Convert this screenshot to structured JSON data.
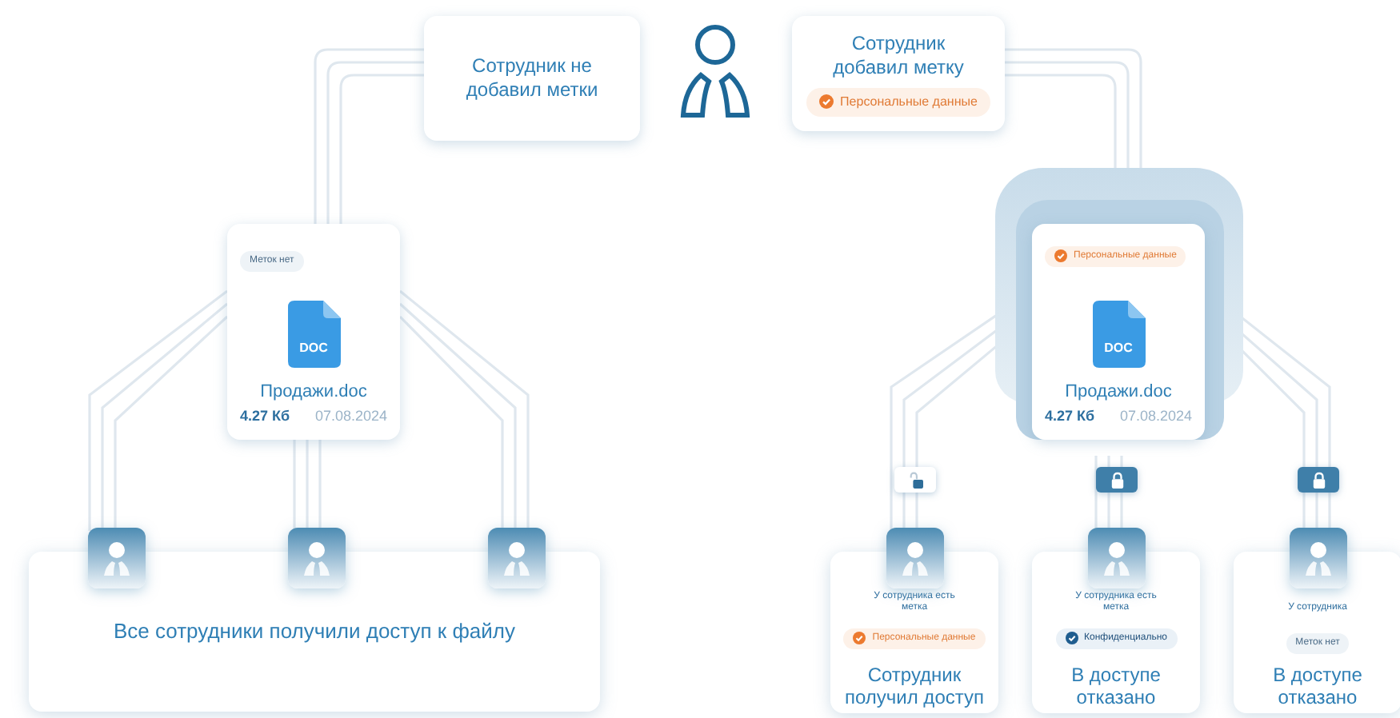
{
  "left_prompt": {
    "text": "Сотрудник не добавил метки"
  },
  "right_prompt": {
    "text": "Сотрудник добавил метку",
    "tag": {
      "kind": "personal",
      "label": "Персональные данные"
    }
  },
  "files": [
    {
      "highlighted": false,
      "tag": {
        "kind": "none",
        "label": "Меток нет"
      },
      "icon_label": "DOC",
      "name": "Продажи.doc",
      "size": "4.27 Кб",
      "date": "07.08.2024"
    },
    {
      "highlighted": true,
      "tag": {
        "kind": "personal",
        "label": "Персональные данные"
      },
      "icon_label": "DOC",
      "name": "Продажи.doc",
      "size": "4.27 Кб",
      "date": "07.08.2024"
    }
  ],
  "all_access": {
    "text": "Все сотрудники получили доступ к файлу"
  },
  "results": [
    {
      "locked": false,
      "note": "У сотрудника есть метка",
      "tag": {
        "kind": "personal",
        "label": "Персональные данные"
      },
      "title": "Сотрудник получил доступ"
    },
    {
      "locked": true,
      "note": "У сотрудника есть метка",
      "tag": {
        "kind": "confidential",
        "label": "Конфиденциально"
      },
      "title": "В доступе отказано"
    },
    {
      "locked": true,
      "note": "У сотрудника",
      "tag": {
        "kind": "none",
        "label": "Меток нет"
      },
      "title": "В доступе отказано"
    }
  ]
}
